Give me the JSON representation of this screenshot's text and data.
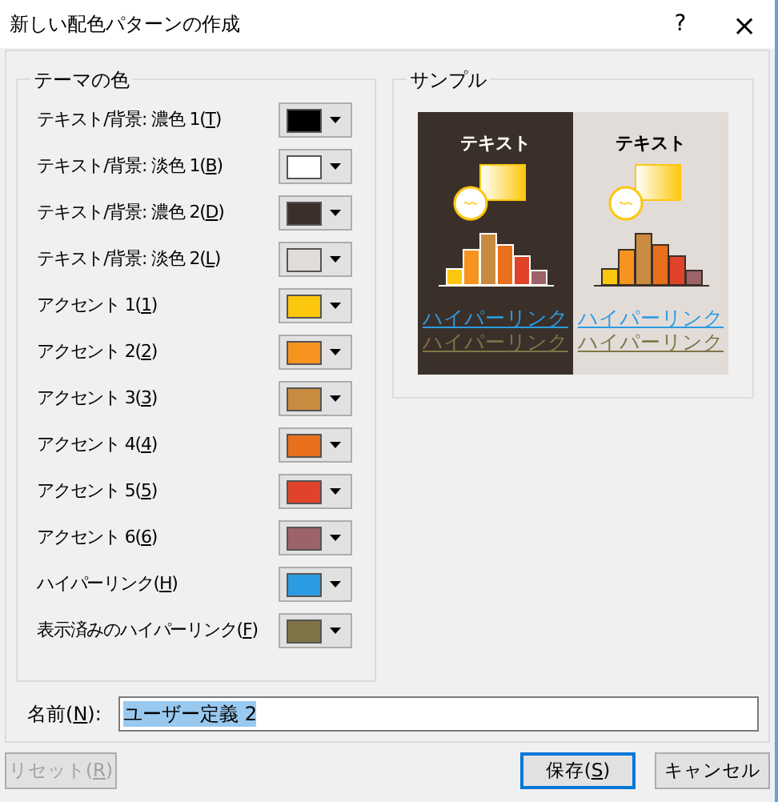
{
  "window": {
    "title": "新しい配色パターンの作成",
    "help": "?",
    "close": "×"
  },
  "theme_colors": {
    "title": "テーマの色",
    "items": [
      {
        "label": "テキスト/背景: 濃色 1(T)",
        "color": "#000000"
      },
      {
        "label": "テキスト/背景: 淡色 1(B)",
        "color": "#ffffff"
      },
      {
        "label": "テキスト/背景: 濃色 2(D)",
        "color": "#3b3029"
      },
      {
        "label": "テキスト/背景: 淡色 2(L)",
        "color": "#e2dcd8"
      },
      {
        "label": "アクセント 1(1)",
        "color": "#fdc70d"
      },
      {
        "label": "アクセント 2(2)",
        "color": "#f7931f"
      },
      {
        "label": "アクセント 3(3)",
        "color": "#c98b3f"
      },
      {
        "label": "アクセント 4(4)",
        "color": "#e86f1c"
      },
      {
        "label": "アクセント 5(5)",
        "color": "#e0432a"
      },
      {
        "label": "アクセント 6(6)",
        "color": "#9c6468"
      },
      {
        "label": "ハイパーリンク(H)",
        "color": "#2b9be3"
      },
      {
        "label": "表示済みのハイパーリンク(F)",
        "color": "#7f7446"
      }
    ]
  },
  "sample": {
    "title": "サンプル",
    "panels": [
      {
        "title": "テキスト",
        "link": "ハイパーリンク",
        "visited_link": "ハイパーリンク"
      },
      {
        "title": "テキスト",
        "link": "ハイパーリンク",
        "visited_link": "ハイパーリンク"
      }
    ]
  },
  "name_field": {
    "label": "名前(N):",
    "value": "ユーザー定義 2"
  },
  "buttons": [
    {
      "label": "リセット(R)",
      "disabled": true,
      "default": false
    },
    {
      "label": "保存(S)",
      "disabled": false,
      "default": true
    },
    {
      "label": "キャンセル",
      "disabled": false,
      "default": false
    }
  ]
}
